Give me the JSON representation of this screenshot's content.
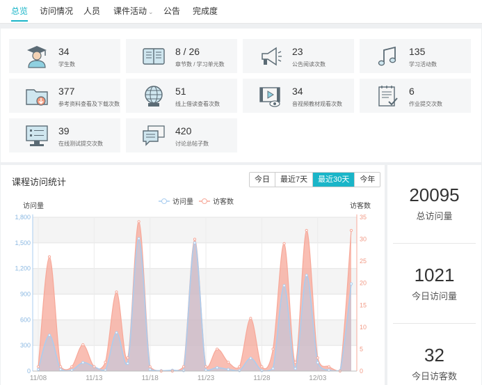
{
  "nav": {
    "tabs": [
      {
        "label": "总览",
        "active": true
      },
      {
        "label": "访问情况"
      },
      {
        "label": "人员"
      },
      {
        "label": "课件活动",
        "dropdown": true
      },
      {
        "label": "公告"
      },
      {
        "label": "完成度"
      }
    ]
  },
  "stats": [
    {
      "value": "34",
      "label": "学生数",
      "icon": "graduate-icon"
    },
    {
      "value": "8 / 26",
      "label": "章节数 / 学习单元数",
      "icon": "book-icon"
    },
    {
      "value": "23",
      "label": "公告阅读次数",
      "icon": "megaphone-icon"
    },
    {
      "value": "135",
      "label": "学习活动数",
      "icon": "music-note-icon"
    },
    {
      "value": "377",
      "label": "参考资料查看及下载次数",
      "icon": "folder-download-icon"
    },
    {
      "value": "51",
      "label": "线上借读查看次数",
      "icon": "globe-icon"
    },
    {
      "value": "34",
      "label": "音视频教材观看次数",
      "icon": "video-icon"
    },
    {
      "value": "6",
      "label": "作业提交次数",
      "icon": "assignment-icon"
    },
    {
      "value": "39",
      "label": "在线测试提交次数",
      "icon": "test-monitor-icon"
    },
    {
      "value": "420",
      "label": "讨论总帖子数",
      "icon": "chat-icon"
    }
  ],
  "chart_section": {
    "title": "课程访问统计",
    "ranges": [
      "今日",
      "最近7天",
      "最近30天",
      "今年"
    ],
    "active_range": "最近30天"
  },
  "summary": [
    {
      "value": "20095",
      "label": "总访问量"
    },
    {
      "value": "1021",
      "label": "今日访问量"
    },
    {
      "value": "32",
      "label": "今日访客数"
    }
  ],
  "colors": {
    "accent": "#1ab5c8",
    "visits": "#a9cdf0",
    "visitors": "#f7a899"
  },
  "chart_data": {
    "type": "area",
    "x_ticks": [
      "11/08",
      "11/13",
      "11/18",
      "11/23",
      "11/28",
      "12/03"
    ],
    "ylabel_left": "访问量",
    "ylabel_right": "访客数",
    "ylim_left": [
      0,
      1800
    ],
    "ylim_right": [
      0,
      35
    ],
    "yticks_left": [
      "0",
      "300",
      "600",
      "900",
      "1,200",
      "1,500",
      "1,800"
    ],
    "yticks_right": [
      "0",
      "5",
      "10",
      "15",
      "20",
      "25",
      "30",
      "35"
    ],
    "legend_position": "top-center",
    "series": [
      {
        "name": "访问量",
        "axis": "left",
        "values": [
          20,
          420,
          20,
          10,
          100,
          50,
          10,
          450,
          90,
          1550,
          20,
          5,
          10,
          5,
          1500,
          10,
          40,
          20,
          5,
          150,
          5,
          30,
          1000,
          30,
          1120,
          100,
          10,
          5,
          1020
        ]
      },
      {
        "name": "访客数",
        "axis": "right",
        "values": [
          1,
          26,
          1,
          1,
          6,
          1,
          2,
          18,
          3,
          34,
          1,
          0,
          0,
          1,
          30,
          1,
          5,
          2,
          1,
          12,
          1,
          5,
          29,
          2,
          32,
          3,
          1,
          0,
          32
        ]
      }
    ]
  }
}
